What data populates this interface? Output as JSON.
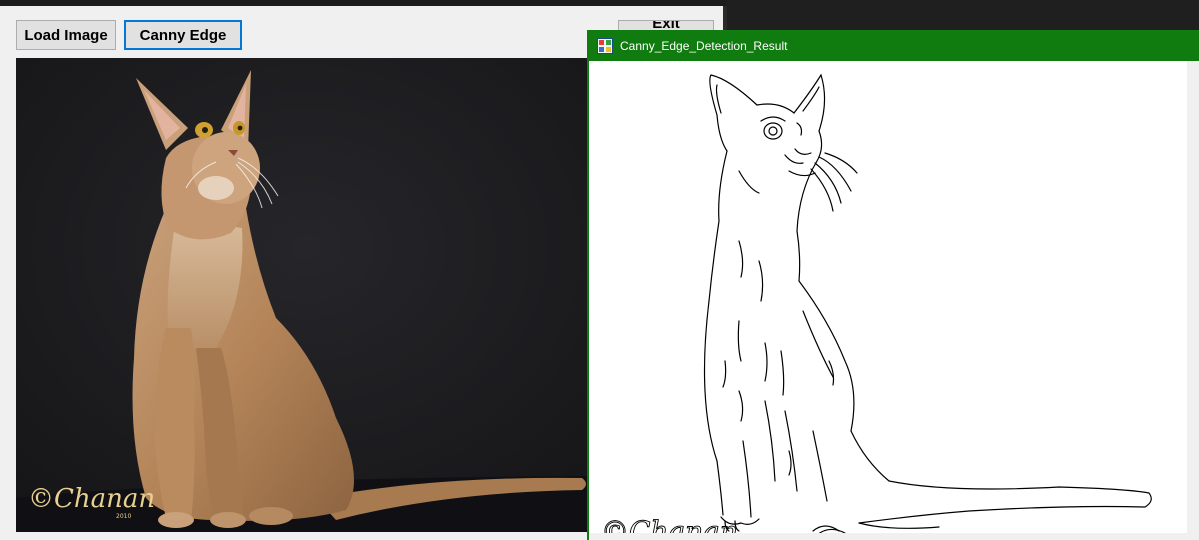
{
  "main_form": {
    "load_button_label": "Load Image",
    "canny_button_label": "Canny Edge",
    "exit_button_label": "Exit"
  },
  "source_image": {
    "watermark_text": "©Chanan",
    "watermark_year": "2010"
  },
  "result_window": {
    "title": "Canny_Edge_Detection_Result",
    "titlebar_color": "#107c10",
    "icon": "app-window-icon",
    "watermark_text": "©Chanan"
  }
}
